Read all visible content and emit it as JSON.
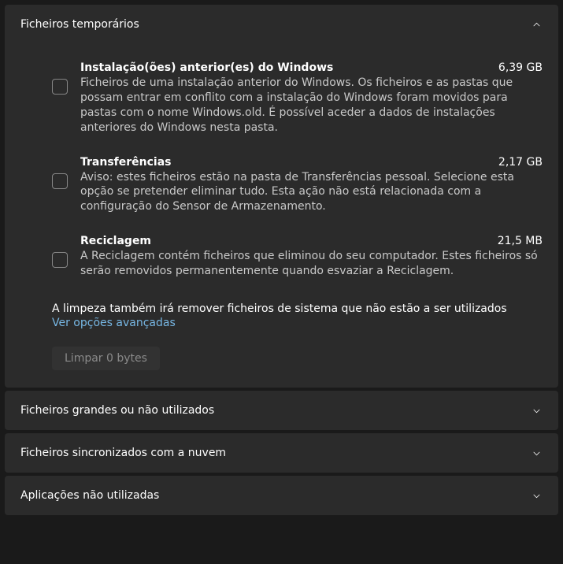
{
  "sections": {
    "temp": {
      "title": "Ficheiros temporários"
    },
    "large": {
      "title": "Ficheiros grandes ou não utilizados"
    },
    "cloud": {
      "title": "Ficheiros sincronizados com a nuvem"
    },
    "apps": {
      "title": "Aplicações não utilizadas"
    }
  },
  "options": [
    {
      "title": "Instalação(ões) anterior(es) do Windows",
      "size": "6,39 GB",
      "desc": "Ficheiros de uma instalação anterior do Windows. Os ficheiros e as pastas que possam entrar em conflito com a instalação do Windows foram movidos para pastas com o nome Windows.old. É possível aceder a dados de instalações anteriores do Windows nesta pasta."
    },
    {
      "title": "Transferências",
      "size": "2,17 GB",
      "desc": "Aviso: estes ficheiros estão na pasta de Transferências pessoal. Selecione esta opção se pretender eliminar tudo. Esta ação não está relacionada com a configuração do Sensor de Armazenamento."
    },
    {
      "title": "Reciclagem",
      "size": "21,5 MB",
      "desc": "A Reciclagem contém ficheiros que eliminou do seu computador. Estes ficheiros só serão removidos permanentemente quando esvaziar a Reciclagem."
    }
  ],
  "note": "A limpeza também irá remover ficheiros de sistema que não estão a ser utilizados",
  "advanced_link": "Ver opções avançadas",
  "clean_button": "Limpar 0 bytes"
}
